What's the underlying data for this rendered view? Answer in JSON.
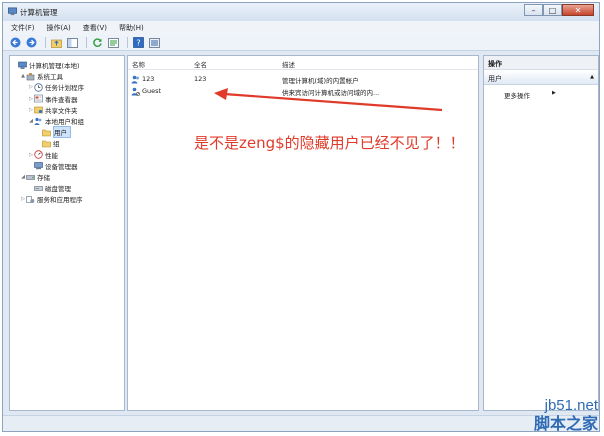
{
  "window": {
    "title": "计算机管理"
  },
  "menu": [
    "文件(F)",
    "操作(A)",
    "查看(V)",
    "帮助(H)"
  ],
  "tree": [
    {
      "label": "计算机管理(本地)",
      "icon": "computer-icon",
      "level": 0,
      "expander": ""
    },
    {
      "label": "系统工具",
      "icon": "tools-icon",
      "level": 1,
      "expander": "▲"
    },
    {
      "label": "任务计划程序",
      "icon": "clock-icon",
      "level": 2,
      "expander": "▷"
    },
    {
      "label": "事件查看器",
      "icon": "event-viewer-icon",
      "level": 2,
      "expander": "▷"
    },
    {
      "label": "共享文件夹",
      "icon": "shared-folder-icon",
      "level": 2,
      "expander": "▷"
    },
    {
      "label": "本地用户和组",
      "icon": "users-icon",
      "level": 2,
      "expander": "◢"
    },
    {
      "label": "用户",
      "icon": "folder-icon",
      "level": 3,
      "expander": "",
      "selected": true
    },
    {
      "label": "组",
      "icon": "folder-icon",
      "level": 3,
      "expander": ""
    },
    {
      "label": "性能",
      "icon": "performance-icon",
      "level": 2,
      "expander": "▷"
    },
    {
      "label": "设备管理器",
      "icon": "device-manager-icon",
      "level": 2,
      "expander": ""
    },
    {
      "label": "存储",
      "icon": "storage-icon",
      "level": 1,
      "expander": "◢"
    },
    {
      "label": "磁盘管理",
      "icon": "disk-icon",
      "level": 2,
      "expander": ""
    },
    {
      "label": "服务和应用程序",
      "icon": "services-icon",
      "level": 1,
      "expander": "▷"
    }
  ],
  "list": {
    "columns": [
      "名称",
      "全名",
      "描述"
    ],
    "rows": [
      {
        "name": "123",
        "fullname": "123",
        "desc": "管理计算机(域)的内置帐户"
      },
      {
        "name": "Guest",
        "fullname": "",
        "desc": "供来宾访问计算机或访问域的内..."
      }
    ]
  },
  "actions": {
    "title": "操作",
    "section": "用户",
    "item": "更多操作"
  },
  "annotation": "是不是zeng$的隐藏用户已经不见了！！",
  "watermark": {
    "line1": "jb51.net",
    "line2": "脚本之家"
  },
  "colors": {
    "annotation": "#e03a2a",
    "watermark": "#2f6bb5",
    "selection": "#cde3fb"
  }
}
